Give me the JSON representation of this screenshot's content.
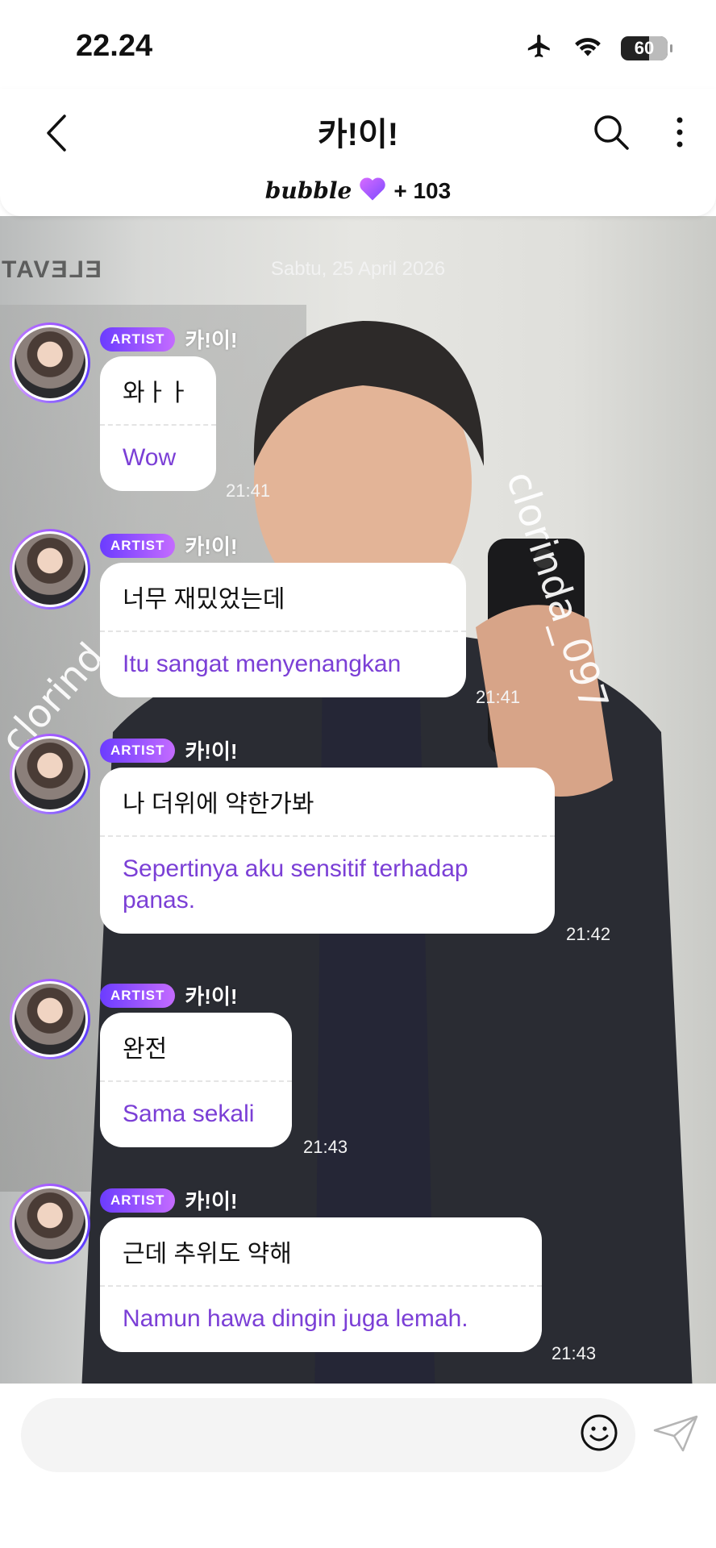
{
  "status": {
    "time": "22.24",
    "battery": "60"
  },
  "header": {
    "title": "카!이!",
    "bubble_label": "bubble",
    "member_count": "+ 103"
  },
  "chat": {
    "date": "Sabtu, 25 April 2026",
    "watermark": "clorinda_097",
    "watermark_partial": "clorind",
    "bg_sign": "ELEVAT",
    "messages": [
      {
        "badge": "ARTIST",
        "sender": "카!이!",
        "original": "와ㅏㅏ",
        "translation": "Wow",
        "time": "21:41"
      },
      {
        "badge": "ARTIST",
        "sender": "카!이!",
        "original": "너무 재밌었는데",
        "translation": "Itu sangat menyenangkan",
        "time": "21:41"
      },
      {
        "badge": "ARTIST",
        "sender": "카!이!",
        "original": "나 더위에 약한가봐",
        "translation": "Sepertinya aku sensitif terhadap panas.",
        "time": "21:42"
      },
      {
        "badge": "ARTIST",
        "sender": "카!이!",
        "original": "완전",
        "translation": "Sama sekali",
        "time": "21:43"
      },
      {
        "badge": "ARTIST",
        "sender": "카!이!",
        "original": "근데 추위도 약해",
        "translation": "Namun hawa dingin juga lemah.",
        "time": "21:43"
      }
    ]
  },
  "input": {
    "placeholder": ""
  },
  "colors": {
    "accent": "#7b3fd6",
    "badge_start": "#6b3cff",
    "badge_end": "#c46bff"
  },
  "icons": [
    "back-icon",
    "search-icon",
    "more-vertical-icon",
    "heart-icon",
    "airplane-icon",
    "wifi-icon",
    "battery-icon",
    "emoji-icon",
    "send-icon"
  ]
}
